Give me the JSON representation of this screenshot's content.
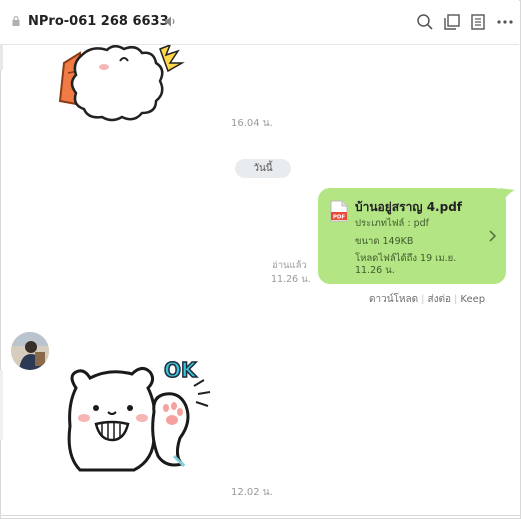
{
  "header": {
    "title": "NPro-061 268 6633",
    "icons": [
      "lock-icon",
      "speaker-icon",
      "search-icon",
      "window-icon",
      "note-icon",
      "more-icon"
    ]
  },
  "messages": {
    "sticker1_time": "16.04 น.",
    "today_label": "วันนี้",
    "file": {
      "name": "บ้านอยู่สราญ 4.pdf",
      "type_line": "ประเภทไฟล์ : pdf",
      "size_line": "ขนาด 149KB",
      "expiry_line1": "โหลดไฟล์ได้ถึง 19 เม.ย.",
      "expiry_line2": "11.26 น.",
      "icon_label": "PDF"
    },
    "read_label": "อ่านแล้ว",
    "read_time": "11.26 น.",
    "actions": {
      "download": "ดาวน์โหลด",
      "share": "ส่งต่อ",
      "keep": "Keep"
    },
    "sticker2_text": "OK",
    "sticker2_time": "12.02 น."
  },
  "colors": {
    "bubble": "#b4e585",
    "ok_text": "#3cc3d6"
  }
}
